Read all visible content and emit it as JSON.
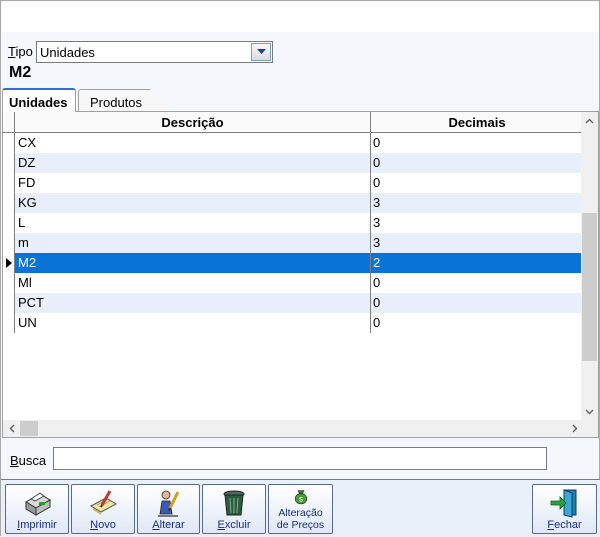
{
  "tipo": {
    "label_prefix": "T",
    "label_rest": "ipo",
    "value": "Unidades"
  },
  "current_title": "M2",
  "tabs": [
    {
      "label": "Unidades",
      "active": true
    },
    {
      "label": "Produtos",
      "active": false
    }
  ],
  "grid": {
    "columns": [
      "Descrição",
      "Decimais"
    ],
    "rows": [
      {
        "descricao": "CX",
        "decimais": "0"
      },
      {
        "descricao": "DZ",
        "decimais": "0"
      },
      {
        "descricao": "FD",
        "decimais": "0"
      },
      {
        "descricao": "KG",
        "decimais": "3"
      },
      {
        "descricao": "L",
        "decimais": "3"
      },
      {
        "descricao": "m",
        "decimais": "3"
      },
      {
        "descricao": "M2",
        "decimais": "2",
        "selected": true
      },
      {
        "descricao": "Ml",
        "decimais": "0"
      },
      {
        "descricao": "PCT",
        "decimais": "0"
      },
      {
        "descricao": "UN",
        "decimais": "0"
      }
    ]
  },
  "busca": {
    "label_prefix": "B",
    "label_rest": "usca",
    "value": ""
  },
  "toolbar": {
    "imprimir": {
      "u": "I",
      "rest": "mprimir",
      "icon": "printer-icon"
    },
    "novo": {
      "u": "N",
      "rest": "ovo",
      "icon": "new-document-icon"
    },
    "alterar": {
      "u": "A",
      "rest": "lterar",
      "icon": "edit-user-icon"
    },
    "excluir": {
      "u": "E",
      "rest": "xcluir",
      "icon": "trash-icon"
    },
    "preco": {
      "line1": "Alteração",
      "line2": "de Preços",
      "icon": "money-bag-icon"
    },
    "fechar": {
      "u": "F",
      "rest": "echar",
      "icon": "exit-door-icon"
    }
  },
  "colors": {
    "selection": "#0a73d6",
    "alt_row": "#e8eefa",
    "toolbar_text": "#1a2d7a"
  }
}
